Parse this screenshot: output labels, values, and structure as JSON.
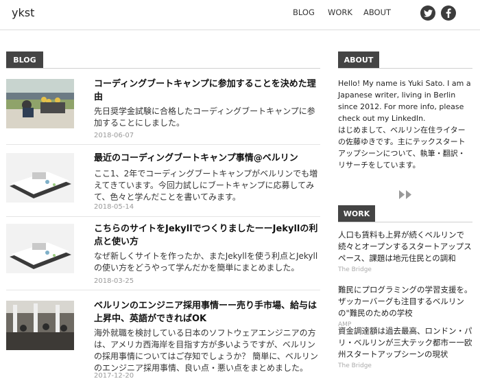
{
  "site": {
    "logo": "ykst"
  },
  "nav": {
    "blog": "BLOG",
    "work": "WORK",
    "about": "ABOUT"
  },
  "social": {
    "twitter": "twitter-icon",
    "facebook": "facebook-icon"
  },
  "blog": {
    "section_label": "BLOG",
    "posts": [
      {
        "title": "コーディングブートキャンプに参加することを決めた理由",
        "excerpt": "先日奨学金試験に合格したコーディングブートキャンプに参加することにしました。",
        "date": "2018-06-07"
      },
      {
        "title": "最近のコーディングブートキャンプ事情@ベルリン",
        "excerpt": "ここ1、2年でコーディングブートキャンプがベルリンでも増えてきています。今回力試しにブートキャンプに応募してみて、色々と学んだことを書いてみます。",
        "date": "2018-05-14"
      },
      {
        "title": "こちらのサイトをJekyllでつくりましたーーJekyllの利点と使い方",
        "excerpt": "なぜ新しくサイトを作ったか、またJekyllを使う利点とJekyllの使い方をどうやって学んだかを簡単にまとめました。",
        "date": "2018-03-25"
      },
      {
        "title": "ベルリンのエンジニア採用事情ーー売り手市場、給与は上昇中、英語ができればOK",
        "excerpt": "海外就職を検討している日本のソフトウェアエンジニアの方は、アメリカ西海岸を目指す方が多いようですが、ベルリンの採用事情についてはご存知でしょうか？ 簡単に、ベルリンのエンジニア採用事情、良い点・悪い点をまとめました。",
        "date": "2017-12-20"
      }
    ]
  },
  "about": {
    "section_label": "ABOUT",
    "text_en": "Hello! My name is Yuki Sato. I am a Japanese writer, living in Berlin since 2012. For more info, please check out my LinkedIn.",
    "text_ja": "はじめまして、ベルリン在住ライターの佐藤ゆきです。主にテックスタートアップシーンについて、執筆・翻訳・リサーチをしています。"
  },
  "work": {
    "section_label": "WORK",
    "items": [
      {
        "title": "人口も賃料も上昇が続くベルリンで続々とオープンするスタートアップスペース、課題は地元住民との調和",
        "source": "The Bridge"
      },
      {
        "title": "難民にプログラミングの学習支援を。ザッカーバーグも注目するベルリンの\"難民のための学校",
        "source": "AMP"
      },
      {
        "title": "資金調達額は過去最高、ロンドン・パリ・ベルリンが三大テック都市ー一欧州スタートアップシーンの現状",
        "source": "The Bridge"
      }
    ]
  },
  "colors": {
    "tab_bg": "#444444",
    "date": "#999999",
    "border": "#dcdcdc"
  }
}
